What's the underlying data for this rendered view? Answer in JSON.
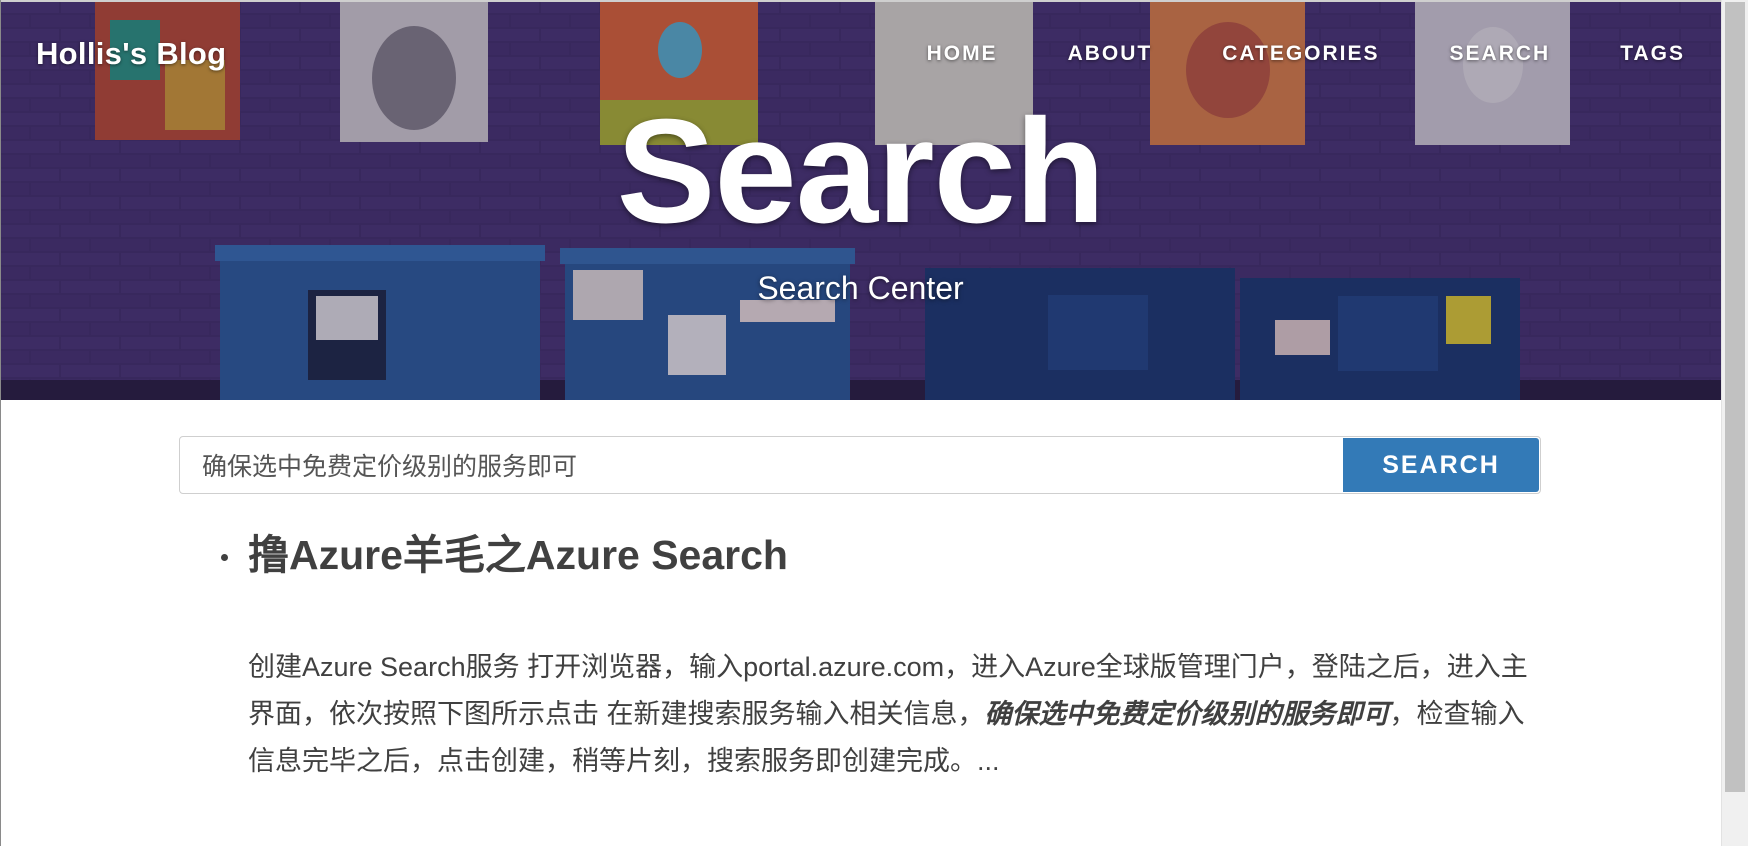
{
  "site": {
    "title": "Hollis's Blog"
  },
  "nav": {
    "items": [
      {
        "label": "HOME"
      },
      {
        "label": "ABOUT"
      },
      {
        "label": "CATEGORIES"
      },
      {
        "label": "SEARCH"
      },
      {
        "label": "TAGS"
      }
    ]
  },
  "hero": {
    "heading": "Search",
    "subheading": "Search Center"
  },
  "search": {
    "value": "确保选中免费定价级别的服务即可",
    "button_label": "SEARCH"
  },
  "results": [
    {
      "title": "撸Azure羊毛之Azure Search",
      "excerpt_before": "创建Azure Search服务 打开浏览器，输入portal.azure.com，进入Azure全球版管理门户，登陆之后，进入主界面，依次按照下图所示点击 在新建搜索服务输入相关信息，",
      "excerpt_highlight": "确保选中免费定价级别的服务即可",
      "excerpt_after": "，检查输入信息完毕之后，点击创建，稍等片刻，搜索服务即创建完成。..."
    }
  ],
  "colors": {
    "accent": "#337ab7",
    "text": "#404040",
    "hero_base": "#3a2c5e"
  }
}
